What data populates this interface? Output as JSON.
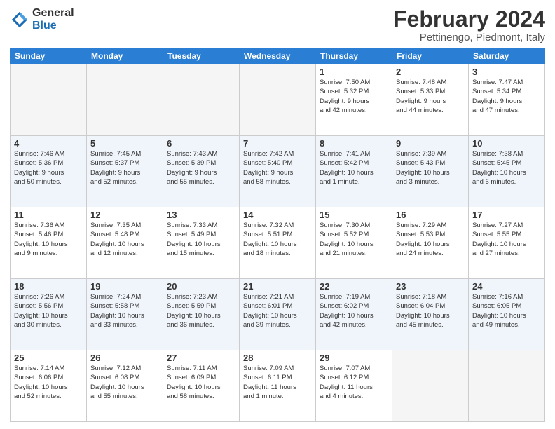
{
  "logo": {
    "text_general": "General",
    "text_blue": "Blue"
  },
  "header": {
    "title": "February 2024",
    "subtitle": "Pettinengo, Piedmont, Italy"
  },
  "weekdays": [
    "Sunday",
    "Monday",
    "Tuesday",
    "Wednesday",
    "Thursday",
    "Friday",
    "Saturday"
  ],
  "weeks": [
    [
      {
        "day": "",
        "info": ""
      },
      {
        "day": "",
        "info": ""
      },
      {
        "day": "",
        "info": ""
      },
      {
        "day": "",
        "info": ""
      },
      {
        "day": "1",
        "info": "Sunrise: 7:50 AM\nSunset: 5:32 PM\nDaylight: 9 hours\nand 42 minutes."
      },
      {
        "day": "2",
        "info": "Sunrise: 7:48 AM\nSunset: 5:33 PM\nDaylight: 9 hours\nand 44 minutes."
      },
      {
        "day": "3",
        "info": "Sunrise: 7:47 AM\nSunset: 5:34 PM\nDaylight: 9 hours\nand 47 minutes."
      }
    ],
    [
      {
        "day": "4",
        "info": "Sunrise: 7:46 AM\nSunset: 5:36 PM\nDaylight: 9 hours\nand 50 minutes."
      },
      {
        "day": "5",
        "info": "Sunrise: 7:45 AM\nSunset: 5:37 PM\nDaylight: 9 hours\nand 52 minutes."
      },
      {
        "day": "6",
        "info": "Sunrise: 7:43 AM\nSunset: 5:39 PM\nDaylight: 9 hours\nand 55 minutes."
      },
      {
        "day": "7",
        "info": "Sunrise: 7:42 AM\nSunset: 5:40 PM\nDaylight: 9 hours\nand 58 minutes."
      },
      {
        "day": "8",
        "info": "Sunrise: 7:41 AM\nSunset: 5:42 PM\nDaylight: 10 hours\nand 1 minute."
      },
      {
        "day": "9",
        "info": "Sunrise: 7:39 AM\nSunset: 5:43 PM\nDaylight: 10 hours\nand 3 minutes."
      },
      {
        "day": "10",
        "info": "Sunrise: 7:38 AM\nSunset: 5:45 PM\nDaylight: 10 hours\nand 6 minutes."
      }
    ],
    [
      {
        "day": "11",
        "info": "Sunrise: 7:36 AM\nSunset: 5:46 PM\nDaylight: 10 hours\nand 9 minutes."
      },
      {
        "day": "12",
        "info": "Sunrise: 7:35 AM\nSunset: 5:48 PM\nDaylight: 10 hours\nand 12 minutes."
      },
      {
        "day": "13",
        "info": "Sunrise: 7:33 AM\nSunset: 5:49 PM\nDaylight: 10 hours\nand 15 minutes."
      },
      {
        "day": "14",
        "info": "Sunrise: 7:32 AM\nSunset: 5:51 PM\nDaylight: 10 hours\nand 18 minutes."
      },
      {
        "day": "15",
        "info": "Sunrise: 7:30 AM\nSunset: 5:52 PM\nDaylight: 10 hours\nand 21 minutes."
      },
      {
        "day": "16",
        "info": "Sunrise: 7:29 AM\nSunset: 5:53 PM\nDaylight: 10 hours\nand 24 minutes."
      },
      {
        "day": "17",
        "info": "Sunrise: 7:27 AM\nSunset: 5:55 PM\nDaylight: 10 hours\nand 27 minutes."
      }
    ],
    [
      {
        "day": "18",
        "info": "Sunrise: 7:26 AM\nSunset: 5:56 PM\nDaylight: 10 hours\nand 30 minutes."
      },
      {
        "day": "19",
        "info": "Sunrise: 7:24 AM\nSunset: 5:58 PM\nDaylight: 10 hours\nand 33 minutes."
      },
      {
        "day": "20",
        "info": "Sunrise: 7:23 AM\nSunset: 5:59 PM\nDaylight: 10 hours\nand 36 minutes."
      },
      {
        "day": "21",
        "info": "Sunrise: 7:21 AM\nSunset: 6:01 PM\nDaylight: 10 hours\nand 39 minutes."
      },
      {
        "day": "22",
        "info": "Sunrise: 7:19 AM\nSunset: 6:02 PM\nDaylight: 10 hours\nand 42 minutes."
      },
      {
        "day": "23",
        "info": "Sunrise: 7:18 AM\nSunset: 6:04 PM\nDaylight: 10 hours\nand 45 minutes."
      },
      {
        "day": "24",
        "info": "Sunrise: 7:16 AM\nSunset: 6:05 PM\nDaylight: 10 hours\nand 49 minutes."
      }
    ],
    [
      {
        "day": "25",
        "info": "Sunrise: 7:14 AM\nSunset: 6:06 PM\nDaylight: 10 hours\nand 52 minutes."
      },
      {
        "day": "26",
        "info": "Sunrise: 7:12 AM\nSunset: 6:08 PM\nDaylight: 10 hours\nand 55 minutes."
      },
      {
        "day": "27",
        "info": "Sunrise: 7:11 AM\nSunset: 6:09 PM\nDaylight: 10 hours\nand 58 minutes."
      },
      {
        "day": "28",
        "info": "Sunrise: 7:09 AM\nSunset: 6:11 PM\nDaylight: 11 hours\nand 1 minute."
      },
      {
        "day": "29",
        "info": "Sunrise: 7:07 AM\nSunset: 6:12 PM\nDaylight: 11 hours\nand 4 minutes."
      },
      {
        "day": "",
        "info": ""
      },
      {
        "day": "",
        "info": ""
      }
    ]
  ]
}
